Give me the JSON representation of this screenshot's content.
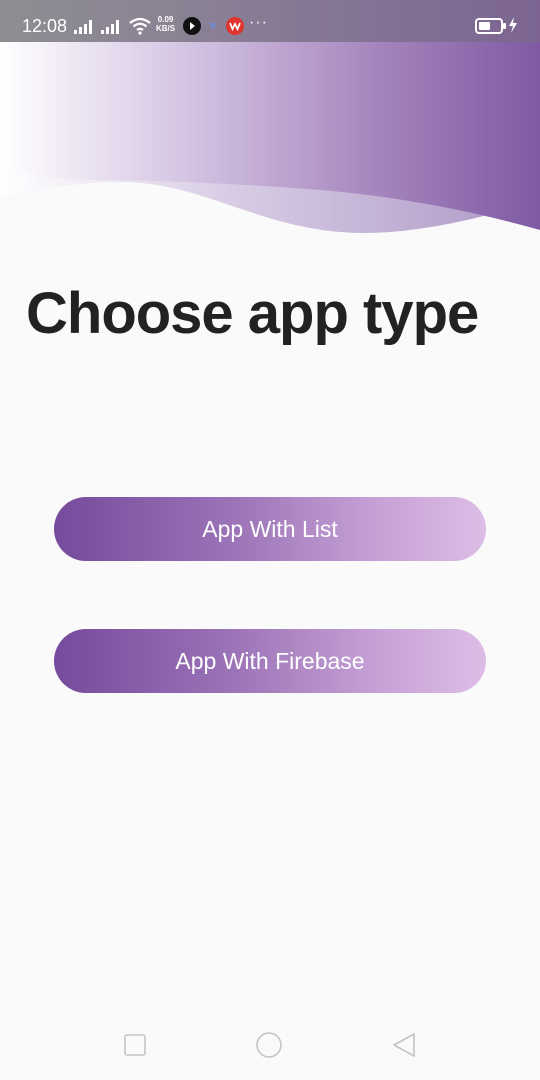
{
  "status_bar": {
    "time": "12:08",
    "network_speed_value": "0.09",
    "network_speed_unit": "KB/S",
    "battery_level": 0.55,
    "icons": [
      "signal-icon",
      "wifi-icon",
      "media-app-icon",
      "vpn-icon",
      "wps-app-icon",
      "more-dots-icon",
      "battery-icon",
      "charging-icon"
    ]
  },
  "main": {
    "title": "Choose app type",
    "buttons": [
      {
        "label": "App With List"
      },
      {
        "label": "App With Firebase"
      }
    ]
  },
  "colors": {
    "accent_dark": "#764a9c",
    "accent_light": "#ddbde6",
    "title_text": "#222222",
    "background": "#fafafa"
  },
  "nav_bar": {
    "icons": [
      "recent-apps-icon",
      "home-icon",
      "back-icon"
    ]
  }
}
